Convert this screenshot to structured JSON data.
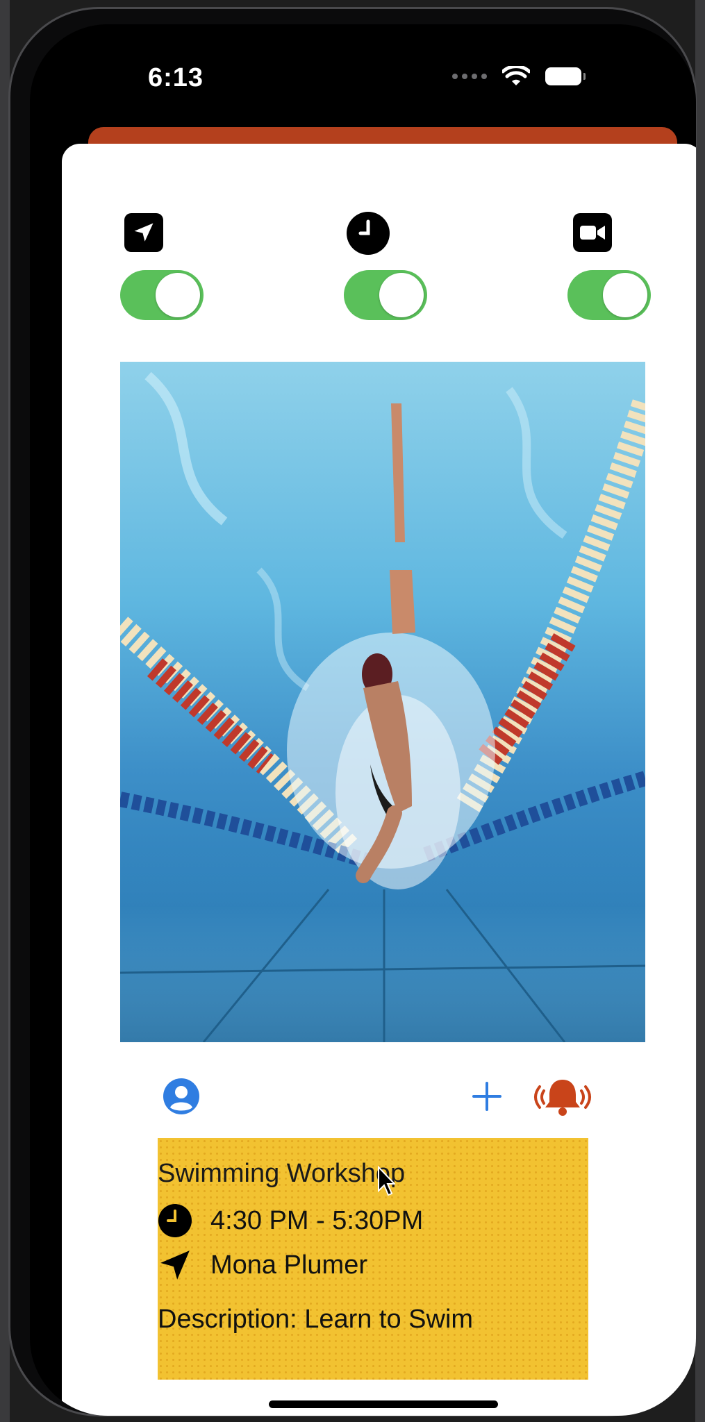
{
  "status_bar": {
    "time": "6:13"
  },
  "toggles": [
    {
      "icon": "location-arrow-icon",
      "on": true
    },
    {
      "icon": "clock-icon",
      "on": true
    },
    {
      "icon": "video-camera-icon",
      "on": true
    }
  ],
  "event": {
    "title": "Swimming Workshop",
    "time_range": "4:30 PM - 5:30PM",
    "location": "Mona Plumer",
    "description": "Description: Learn to Swim"
  },
  "colors": {
    "toggle_green": "#5ac05a",
    "accent_blue": "#2f7de1",
    "alert_orange": "#c9441a",
    "event_yellow": "#f2c231",
    "sheet_orange": "#b4401d"
  },
  "icons": {
    "profile": "person-circle-icon",
    "add": "plus-icon",
    "alarm": "bell-ringing-icon"
  }
}
